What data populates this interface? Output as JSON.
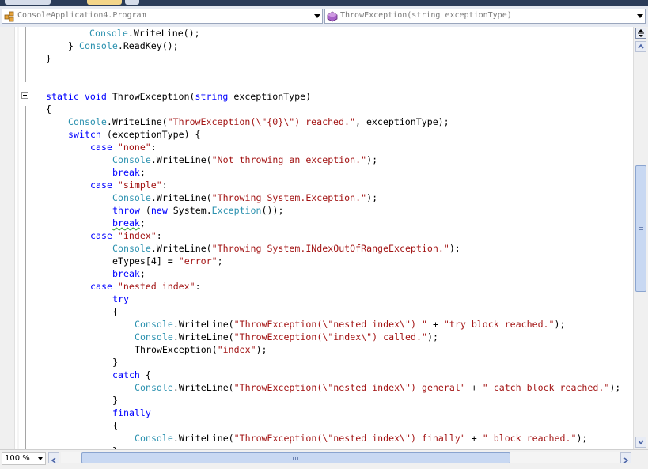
{
  "navbar": {
    "type_combo": "ConsoleApplication4.Program",
    "member_combo": "ThrowException(string exceptionType)"
  },
  "code": {
    "line1": [
      [
        "ty",
        "Console"
      ],
      [
        "",
        "."
      ],
      [
        "",
        "WriteLine();"
      ]
    ],
    "line2": [
      [
        "",
        "} "
      ],
      [
        "ty",
        "Console"
      ],
      [
        "",
        "."
      ],
      [
        "",
        "ReadKey();"
      ]
    ],
    "line3": [
      [
        "",
        "}"
      ]
    ],
    "line4": [
      [
        "kw",
        "static"
      ],
      [
        "",
        " "
      ],
      [
        "kw",
        "void"
      ],
      [
        "",
        " ThrowException("
      ],
      [
        "kw",
        "string"
      ],
      [
        "",
        " exceptionType)"
      ]
    ],
    "line5": [
      [
        "",
        "{"
      ]
    ],
    "line6": [
      [
        "ty",
        "Console"
      ],
      [
        "",
        ".WriteLine("
      ],
      [
        "st",
        "\"ThrowException(\\\"{0}\\\") reached.\""
      ],
      [
        "",
        ", exceptionType);"
      ]
    ],
    "line7": [
      [
        "kw",
        "switch"
      ],
      [
        "",
        " (exceptionType) {"
      ]
    ],
    "line8": [
      [
        "kw",
        "case"
      ],
      [
        "",
        " "
      ],
      [
        "st",
        "\"none\""
      ],
      [
        "",
        ":"
      ]
    ],
    "line9": [
      [
        "ty",
        "Console"
      ],
      [
        "",
        ".WriteLine("
      ],
      [
        "st",
        "\"Not throwing an exception.\""
      ],
      [
        "",
        ");"
      ]
    ],
    "line10": [
      [
        "kw",
        "break"
      ],
      [
        "",
        ";"
      ]
    ],
    "line11": [
      [
        "kw",
        "case"
      ],
      [
        "",
        " "
      ],
      [
        "st",
        "\"simple\""
      ],
      [
        "",
        ":"
      ]
    ],
    "line12": [
      [
        "ty",
        "Console"
      ],
      [
        "",
        ".WriteLine("
      ],
      [
        "st",
        "\"Throwing System.Exception.\""
      ],
      [
        "",
        ");"
      ]
    ],
    "line13": [
      [
        "kw",
        "throw"
      ],
      [
        "",
        " ("
      ],
      [
        "kw",
        "new"
      ],
      [
        "",
        " System."
      ],
      [
        "ty",
        "Exception"
      ],
      [
        "",
        "());"
      ]
    ],
    "line14": [
      [
        "kwsq",
        "break"
      ],
      [
        "",
        ";"
      ]
    ],
    "line15": [
      [
        "kw",
        "case"
      ],
      [
        "",
        " "
      ],
      [
        "st",
        "\"index\""
      ],
      [
        "",
        ":"
      ]
    ],
    "line16": [
      [
        "ty",
        "Console"
      ],
      [
        "",
        ".WriteLine("
      ],
      [
        "st",
        "\"Throwing System.INdexOutOfRangeException.\""
      ],
      [
        "",
        ");"
      ]
    ],
    "line17": [
      [
        "",
        "eTypes[4] = "
      ],
      [
        "st",
        "\"error\""
      ],
      [
        "",
        ";"
      ]
    ],
    "line18": [
      [
        "kw",
        "break"
      ],
      [
        "",
        ";"
      ]
    ],
    "line19": [
      [
        "kw",
        "case"
      ],
      [
        "",
        " "
      ],
      [
        "st",
        "\"nested index\""
      ],
      [
        "",
        ":"
      ]
    ],
    "line20": [
      [
        "kw",
        "try"
      ]
    ],
    "line21": [
      [
        "",
        "{"
      ]
    ],
    "line22": [
      [
        "ty",
        "Console"
      ],
      [
        "",
        ".WriteLine("
      ],
      [
        "st",
        "\"ThrowException(\\\"nested index\\\") \""
      ],
      [
        "",
        " + "
      ],
      [
        "st",
        "\"try block reached.\""
      ],
      [
        "",
        ");"
      ]
    ],
    "line23": [
      [
        "ty",
        "Console"
      ],
      [
        "",
        ".WriteLine("
      ],
      [
        "st",
        "\"ThrowException(\\\"index\\\") called.\""
      ],
      [
        "",
        ");"
      ]
    ],
    "line24": [
      [
        "",
        "ThrowException("
      ],
      [
        "st",
        "\"index\""
      ],
      [
        "",
        ");"
      ]
    ],
    "line25": [
      [
        "",
        "}"
      ]
    ],
    "line26": [
      [
        "kw",
        "catch"
      ],
      [
        "",
        " {"
      ]
    ],
    "line27": [
      [
        "ty",
        "Console"
      ],
      [
        "",
        ".WriteLine("
      ],
      [
        "st",
        "\"ThrowException(\\\"nested index\\\") general\""
      ],
      [
        "",
        " + "
      ],
      [
        "st",
        "\" catch block reached.\""
      ],
      [
        "",
        ");"
      ]
    ],
    "line28": [
      [
        "",
        "}"
      ]
    ],
    "line29": [
      [
        "kw",
        "finally"
      ]
    ],
    "line30": [
      [
        "",
        "{"
      ]
    ],
    "line31": [
      [
        "ty",
        "Console"
      ],
      [
        "",
        ".WriteLine("
      ],
      [
        "st",
        "\"ThrowException(\\\"nested index\\\") finally\""
      ],
      [
        "",
        " + "
      ],
      [
        "st",
        "\" block reached.\""
      ],
      [
        "",
        ");"
      ]
    ],
    "line32": [
      [
        "",
        "}"
      ]
    ]
  },
  "statusbar": {
    "zoom": "100 %"
  },
  "colors": {
    "keyword": "#0000ff",
    "type": "#2b91af",
    "string": "#a31515",
    "selection_accent": "#c8d8f2"
  },
  "icons": {
    "type_combo_icon": "class-icon",
    "member_combo_icon": "method-icon"
  }
}
